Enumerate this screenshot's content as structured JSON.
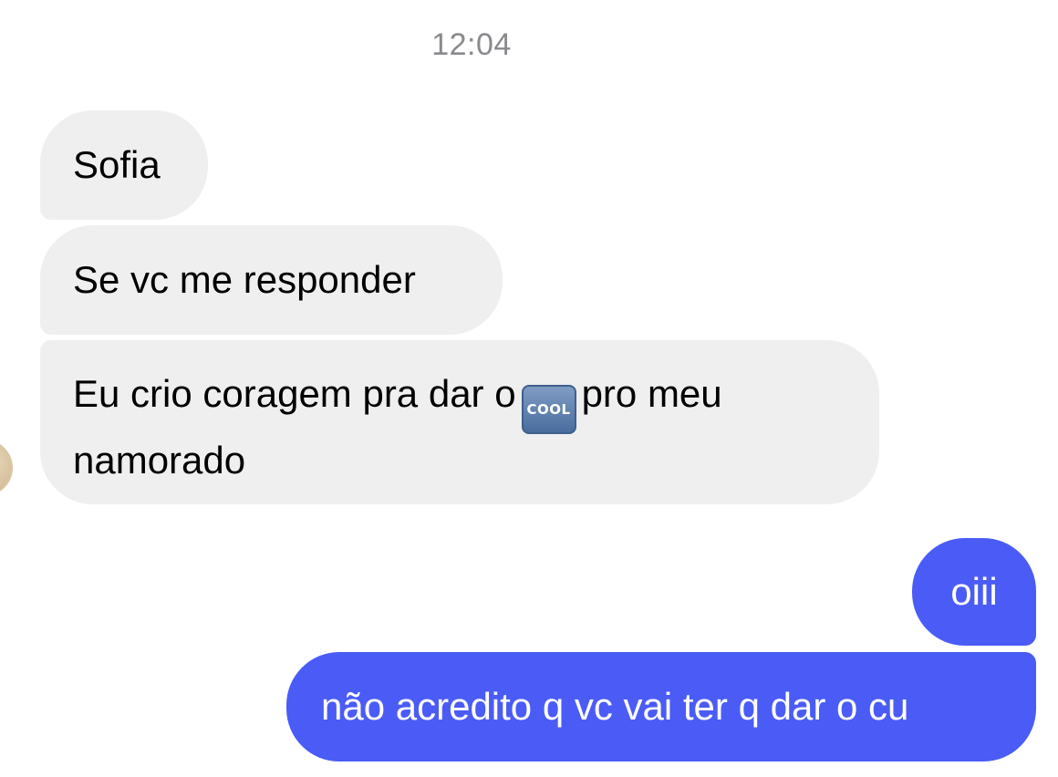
{
  "chat": {
    "timestamp": "12:04",
    "incoming": [
      {
        "text": "Sofia"
      },
      {
        "text": "Se vc me responder"
      },
      {
        "text_before": "Eu crio coragem pra dar o",
        "emoji_label": "COOL",
        "emoji_name": "cool-button-emoji",
        "text_after": "pro meu",
        "text_line2": "namorado"
      }
    ],
    "outgoing": [
      {
        "text": "oiii"
      },
      {
        "text": "não acredito q vc vai ter q dar o cu"
      }
    ]
  },
  "colors": {
    "incoming_bubble": "#efefef",
    "outgoing_bubble": "#4a5cf5",
    "timestamp_text": "#8a8a8e"
  }
}
